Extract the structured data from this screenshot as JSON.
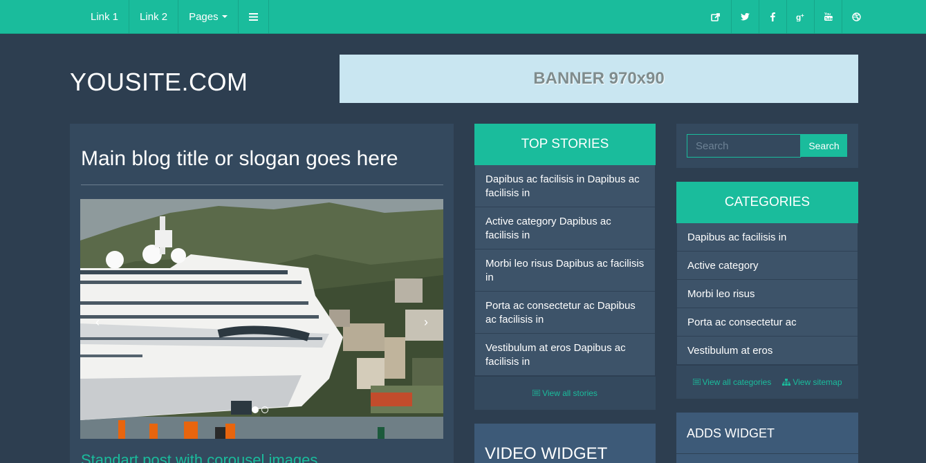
{
  "navbar": {
    "links": [
      "Link 1",
      "Link 2"
    ],
    "pages_label": "Pages",
    "menu_icon": "hamburger-icon",
    "social_icons": [
      "share-icon",
      "twitter-icon",
      "facebook-icon",
      "google-plus-icon",
      "youtube-icon",
      "dribbble-icon"
    ]
  },
  "header": {
    "logo": "YOUSITE.COM",
    "banner": "BANNER 970x90"
  },
  "main": {
    "title": "Main blog title or slogan goes here",
    "post_title": "Standart post with corousel images",
    "carousel": {
      "prev": "‹",
      "next": "›",
      "slides": 2,
      "active_slide": 1
    }
  },
  "top_stories": {
    "title": "TOP STORIES",
    "items": [
      "Dapibus ac facilisis in Dapibus ac facilisis in",
      "Active category Dapibus ac facilisis in",
      "Morbi leo risus Dapibus ac facilisis in",
      "Porta ac consectetur ac Dapibus ac facilisis in",
      "Vestibulum at eros Dapibus ac facilisis in"
    ],
    "view_all": "View all stories"
  },
  "video_widget": {
    "title": "VIDEO WIDGET"
  },
  "search": {
    "placeholder": "Search",
    "button": "Search"
  },
  "categories": {
    "title": "CATEGORIES",
    "items": [
      "Dapibus ac facilisis in",
      "Active category",
      "Morbi leo risus",
      "Porta ac consectetur ac",
      "Vestibulum at eros"
    ],
    "view_all": "View all categories",
    "view_sitemap": "View sitemap"
  },
  "adds_widget": {
    "title": "ADDS WIDGET"
  },
  "colors": {
    "accent": "#1abc9c",
    "background": "#2d3e50",
    "panel": "#34495e"
  }
}
